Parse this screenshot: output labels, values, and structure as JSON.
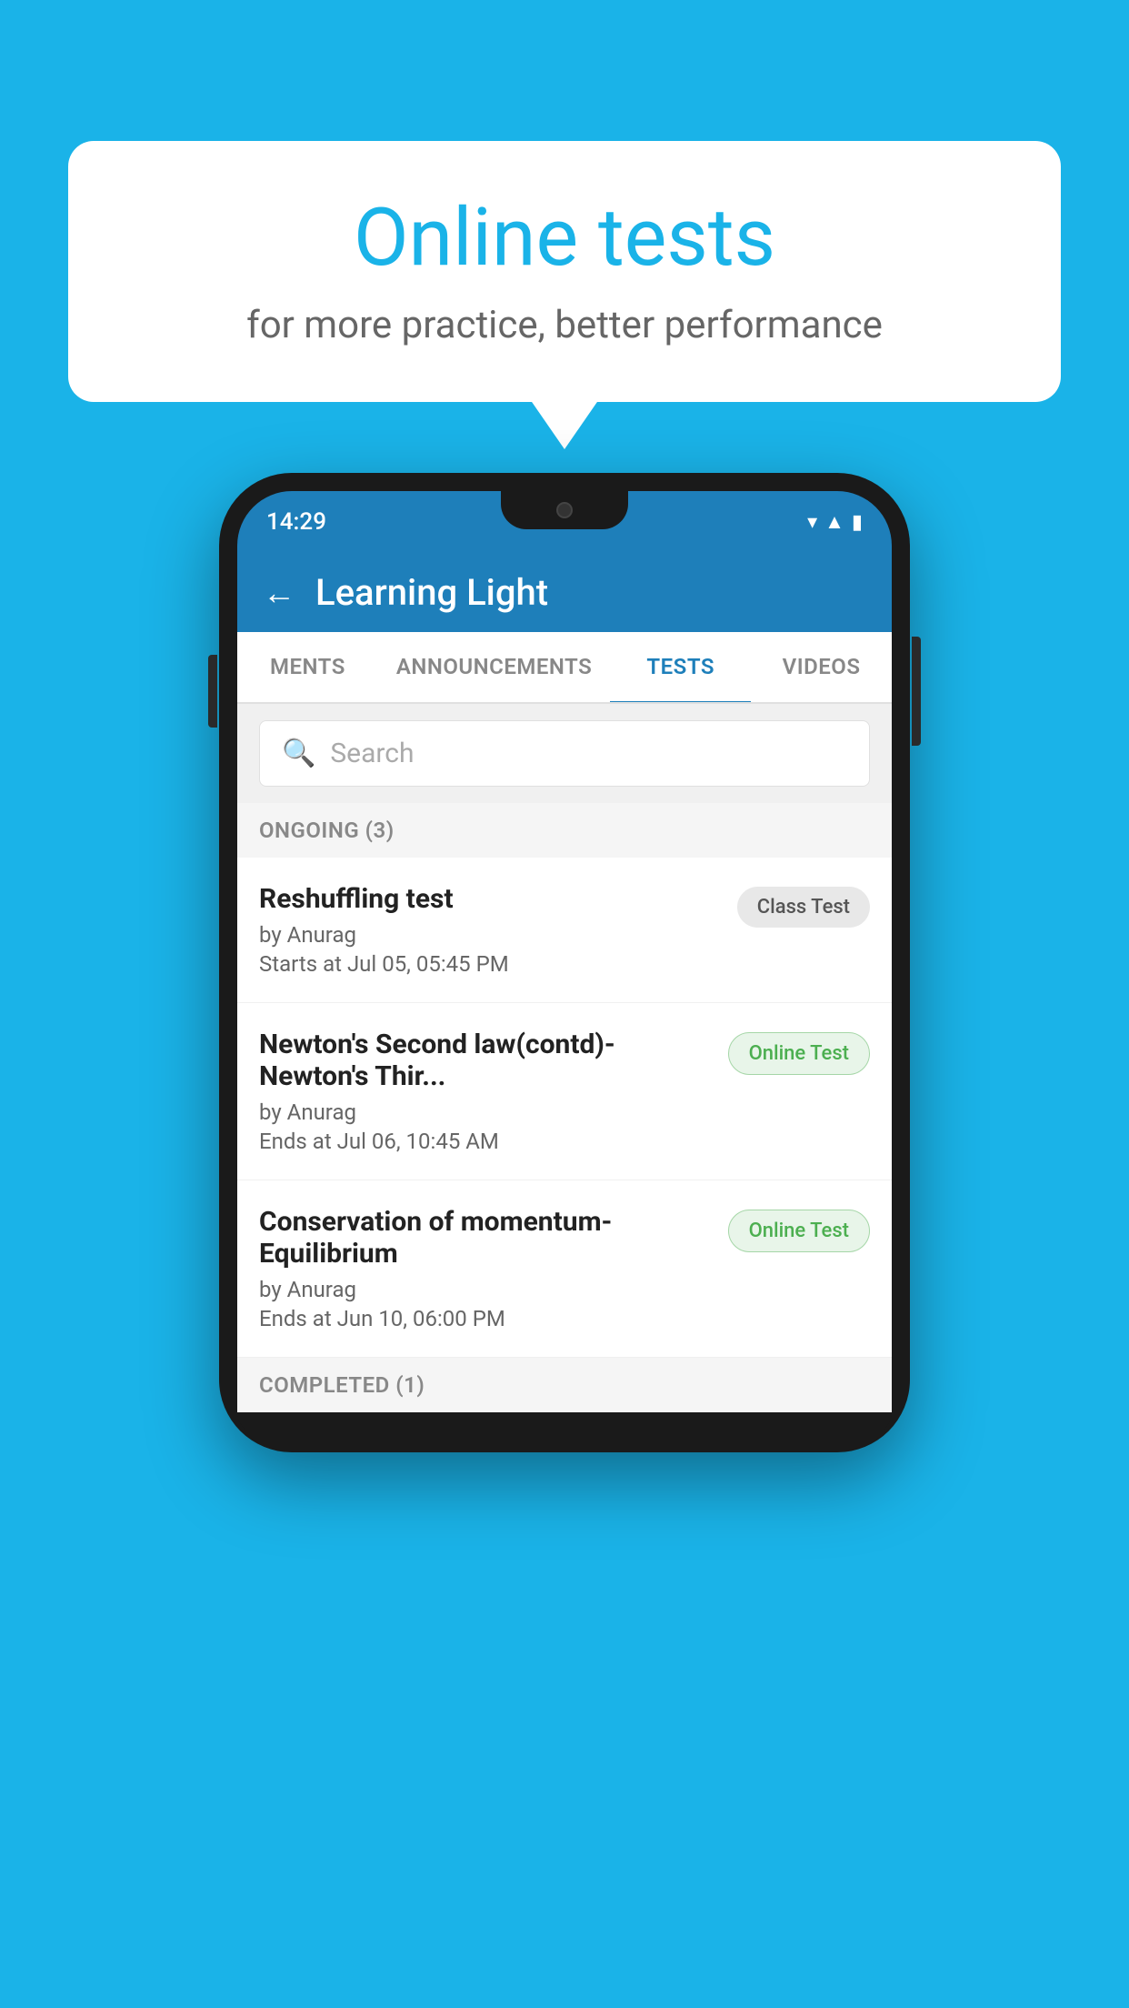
{
  "background": {
    "color": "#1ab3e8"
  },
  "bubble": {
    "title": "Online tests",
    "subtitle": "for more practice, better performance"
  },
  "phone": {
    "status_bar": {
      "time": "14:29",
      "wifi_icon": "▾",
      "signal_icon": "▲",
      "battery_icon": "▮"
    },
    "header": {
      "back_label": "←",
      "app_name": "Learning Light"
    },
    "tabs": [
      {
        "label": "MENTS",
        "active": false
      },
      {
        "label": "ANNOUNCEMENTS",
        "active": false
      },
      {
        "label": "TESTS",
        "active": true
      },
      {
        "label": "VIDEOS",
        "active": false
      }
    ],
    "search": {
      "placeholder": "Search"
    },
    "section_ongoing": {
      "label": "ONGOING (3)"
    },
    "tests": [
      {
        "name": "Reshuffling test",
        "by": "by Anurag",
        "time_label": "Starts at",
        "time": "Jul 05, 05:45 PM",
        "badge": "Class Test",
        "badge_type": "class"
      },
      {
        "name": "Newton's Second law(contd)-Newton's Thir...",
        "by": "by Anurag",
        "time_label": "Ends at",
        "time": "Jul 06, 10:45 AM",
        "badge": "Online Test",
        "badge_type": "online"
      },
      {
        "name": "Conservation of momentum-Equilibrium",
        "by": "by Anurag",
        "time_label": "Ends at",
        "time": "Jun 10, 06:00 PM",
        "badge": "Online Test",
        "badge_type": "online"
      }
    ],
    "section_completed": {
      "label": "COMPLETED (1)"
    }
  }
}
